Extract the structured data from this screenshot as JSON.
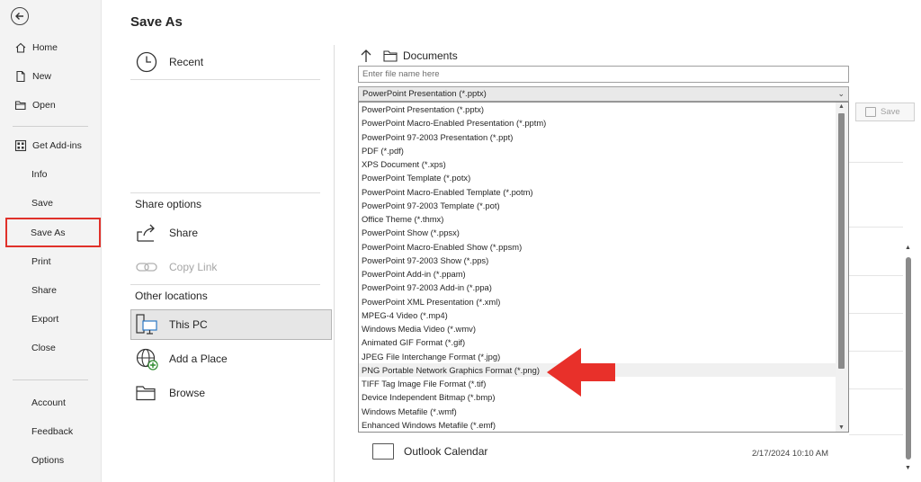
{
  "nav": {
    "home": "Home",
    "new": "New",
    "open": "Open",
    "get_addins": "Get Add-ins",
    "info": "Info",
    "save": "Save",
    "save_as": "Save As",
    "print": "Print",
    "share": "Share",
    "export": "Export",
    "close": "Close",
    "account": "Account",
    "feedback": "Feedback",
    "options": "Options"
  },
  "page_title": "Save As",
  "locations": {
    "recent": "Recent",
    "share_options_header": "Share options",
    "share": "Share",
    "copy_link": "Copy Link",
    "other_locations_header": "Other locations",
    "this_pc": "This PC",
    "add_place": "Add a Place",
    "browse": "Browse"
  },
  "path": {
    "folder": "Documents"
  },
  "filename": {
    "placeholder": "Enter file name here",
    "value": ""
  },
  "filetype": {
    "selected": "PowerPoint Presentation (*.pptx)",
    "options": [
      "PowerPoint Presentation (*.pptx)",
      "PowerPoint Macro-Enabled Presentation (*.pptm)",
      "PowerPoint 97-2003 Presentation (*.ppt)",
      "PDF (*.pdf)",
      "XPS Document (*.xps)",
      "PowerPoint Template (*.potx)",
      "PowerPoint Macro-Enabled Template (*.potm)",
      "PowerPoint 97-2003 Template (*.pot)",
      "Office Theme (*.thmx)",
      "PowerPoint Show (*.ppsx)",
      "PowerPoint Macro-Enabled Show (*.ppsm)",
      "PowerPoint 97-2003 Show (*.pps)",
      "PowerPoint Add-in (*.ppam)",
      "PowerPoint 97-2003 Add-in (*.ppa)",
      "PowerPoint XML Presentation (*.xml)",
      "MPEG-4 Video (*.mp4)",
      "Windows Media Video (*.wmv)",
      "Animated GIF Format (*.gif)",
      "JPEG File Interchange Format (*.jpg)",
      "PNG Portable Network Graphics Format (*.png)",
      "TIFF Tag Image File Format (*.tif)",
      "Device Independent Bitmap (*.bmp)",
      "Windows Metafile (*.wmf)",
      "Enhanced Windows Metafile (*.emf)"
    ],
    "highlighted_index": 19
  },
  "save_button": "Save",
  "files": [
    {
      "name": "Outlook Calendar",
      "date": "2/17/2024 10:10 AM"
    }
  ],
  "colors": {
    "highlight_border": "#e0312a",
    "annotation_arrow": "#e8302a",
    "nav_bg": "#f3f3f3"
  }
}
